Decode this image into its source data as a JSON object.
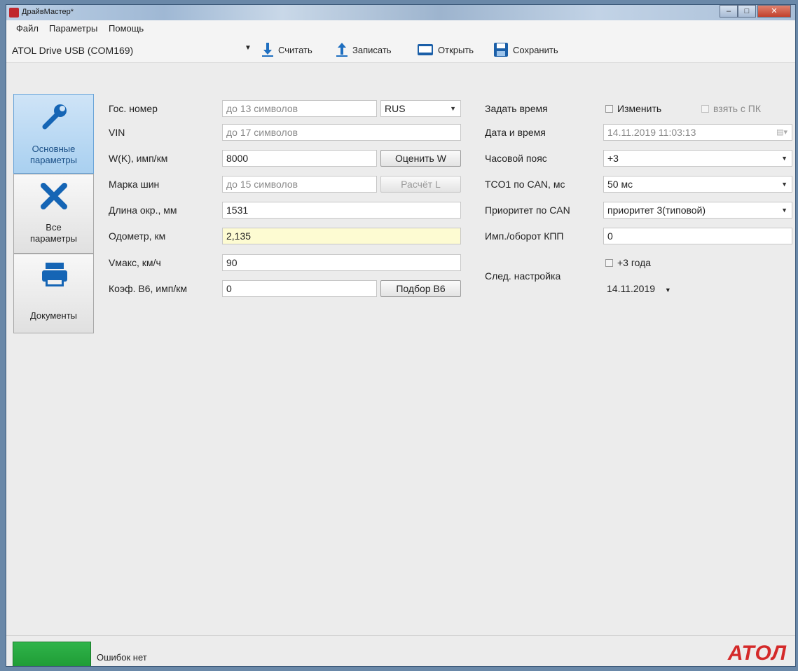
{
  "window": {
    "title": "ДрайвМастер*"
  },
  "menu": {
    "items": [
      "Файл",
      "Параметры",
      "Помощь"
    ]
  },
  "toolbar": {
    "port": "ATOL Drive USB (COM169)",
    "read_label": "Считать",
    "write_label": "Записать",
    "open_label": "Открыть",
    "save_label": "Сохранить"
  },
  "nav": {
    "basic_line1": "Основные",
    "basic_line2": "параметры",
    "all_line1": "Все",
    "all_line2": "параметры",
    "documents": "Документы"
  },
  "form": {
    "plate_label": "Гос. номер",
    "plate_placeholder": "до 13 символов",
    "country": "RUS",
    "vin_label": "VIN",
    "vin_placeholder": "до 17 символов",
    "wk_label": "W(K), имп/км",
    "wk_value": "8000",
    "estimate_w_label": "Оценить W",
    "tire_label": "Марка шин",
    "tire_placeholder": "до 15 символов",
    "calc_l_label": "Расчёт L",
    "circ_label": "Длина окр., мм",
    "circ_value": "1531",
    "odo_label": "Одометр, км",
    "odo_value": "2,135",
    "vmax_label": "Vмакс, км/ч",
    "vmax_value": "90",
    "b6_label": "Коэф. B6, имп/км",
    "b6_value": "0",
    "b6_button": "Подбор B6"
  },
  "right": {
    "set_time_label": "Задать время",
    "change_label": "Изменить",
    "from_pc_label": "взять с ПК",
    "datetime_label": "Дата и время",
    "datetime_value": "14.11.2019  11:03:13",
    "tz_label": "Часовой пояс",
    "tz_value": "+3",
    "tco_label": "TCO1 по CAN, мс",
    "tco_value": "50 мс",
    "prio_label": "Приоритет по CAN",
    "prio_value": "приоритет 3(типовой)",
    "imp_label": "Имп./оборот КПП",
    "imp_value": "0",
    "next_label": "След. настройка",
    "plus3_label": "+3 года",
    "next_date": "14.11.2019"
  },
  "status": {
    "text": "Ошибок нет",
    "logo": "АТОЛ",
    "led_color": "#2fb44a"
  }
}
